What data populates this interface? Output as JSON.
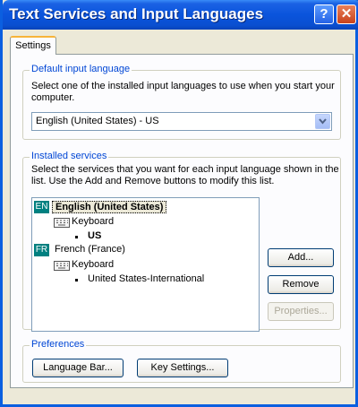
{
  "window": {
    "title": "Text Services and Input Languages",
    "help_glyph": "?",
    "close_glyph": "✕"
  },
  "tabs": [
    {
      "label": "Settings",
      "active": true
    }
  ],
  "default_input_language": {
    "group_label": "Default input language",
    "description_line1": "Select one of the installed input languages to use when you start your",
    "description_line2": "computer.",
    "selected": "English (United States) - US"
  },
  "installed_services": {
    "group_label": "Installed services",
    "description_line1": "Select the services that you want for each input language shown in the",
    "description_line2": "list. Use the Add and Remove buttons to modify this list.",
    "languages": [
      {
        "badge": "EN",
        "name": "English (United States)",
        "selected": true,
        "category": "Keyboard",
        "layout": "US"
      },
      {
        "badge": "FR",
        "name": "French (France)",
        "selected": false,
        "category": "Keyboard",
        "layout": "United States-International"
      }
    ],
    "buttons": {
      "add": "Add...",
      "remove": "Remove",
      "properties": "Properties..."
    }
  },
  "preferences": {
    "group_label": "Preferences",
    "language_bar": "Language Bar...",
    "key_settings": "Key Settings..."
  },
  "colors": {
    "title_bar": "#0a54dc",
    "group_label": "#0046d5",
    "language_badge": "#008080",
    "dialog_background": "#ece9d8"
  }
}
